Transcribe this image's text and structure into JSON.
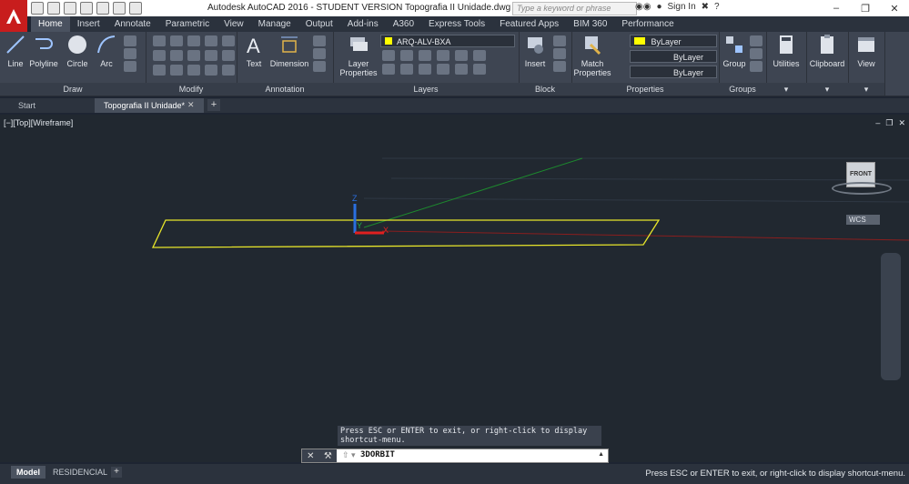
{
  "app": {
    "title": "Autodesk AutoCAD 2016 - STUDENT VERSION    Topografia II Unidade.dwg",
    "search_placeholder": "Type a keyword or phrase",
    "sign_in": "Sign In",
    "logo_letter": "A"
  },
  "ribbon_tabs": [
    "Home",
    "Insert",
    "Annotate",
    "Parametric",
    "View",
    "Manage",
    "Output",
    "Add-ins",
    "A360",
    "Express Tools",
    "Featured Apps",
    "BIM 360",
    "Performance"
  ],
  "ribbon": {
    "draw": {
      "label": "Draw",
      "line": "Line",
      "polyline": "Polyline",
      "circle": "Circle",
      "arc": "Arc"
    },
    "modify": {
      "label": "Modify"
    },
    "annotation": {
      "label": "Annotation",
      "text": "Text",
      "dimension": "Dimension"
    },
    "layers": {
      "label": "Layers",
      "layer_properties": "Layer Properties",
      "current_layer": "ARQ-ALV-BXA"
    },
    "block": {
      "label": "Block",
      "insert": "Insert"
    },
    "properties": {
      "label": "Properties",
      "match": "Match Properties",
      "color": "ByLayer",
      "linetype": "ByLayer",
      "lineweight": "ByLayer"
    },
    "groups": {
      "label": "Groups",
      "group": "Group"
    },
    "utilities": "Utilities",
    "clipboard": "Clipboard",
    "view": "View"
  },
  "doc_tabs": [
    "Start",
    "Topografia II Unidade*"
  ],
  "viewport": {
    "label": "[−][Top][Wireframe]",
    "viewcube_face": "FRONT",
    "wcs": "WCS"
  },
  "command": {
    "message": "Press ESC or ENTER to exit, or right-click to display shortcut-menu.",
    "current": "3DORBIT"
  },
  "layout_tabs": [
    "Model",
    "RESIDENCIAL"
  ],
  "status_message": "Press ESC or ENTER to exit, or right-click to display shortcut-menu.",
  "colors": {
    "accent_red": "#c81d1d",
    "layer_yellow": "#ffff00",
    "ucs_x": "#e02020",
    "ucs_y": "#22b24a",
    "ucs_z": "#2a6fe0"
  }
}
